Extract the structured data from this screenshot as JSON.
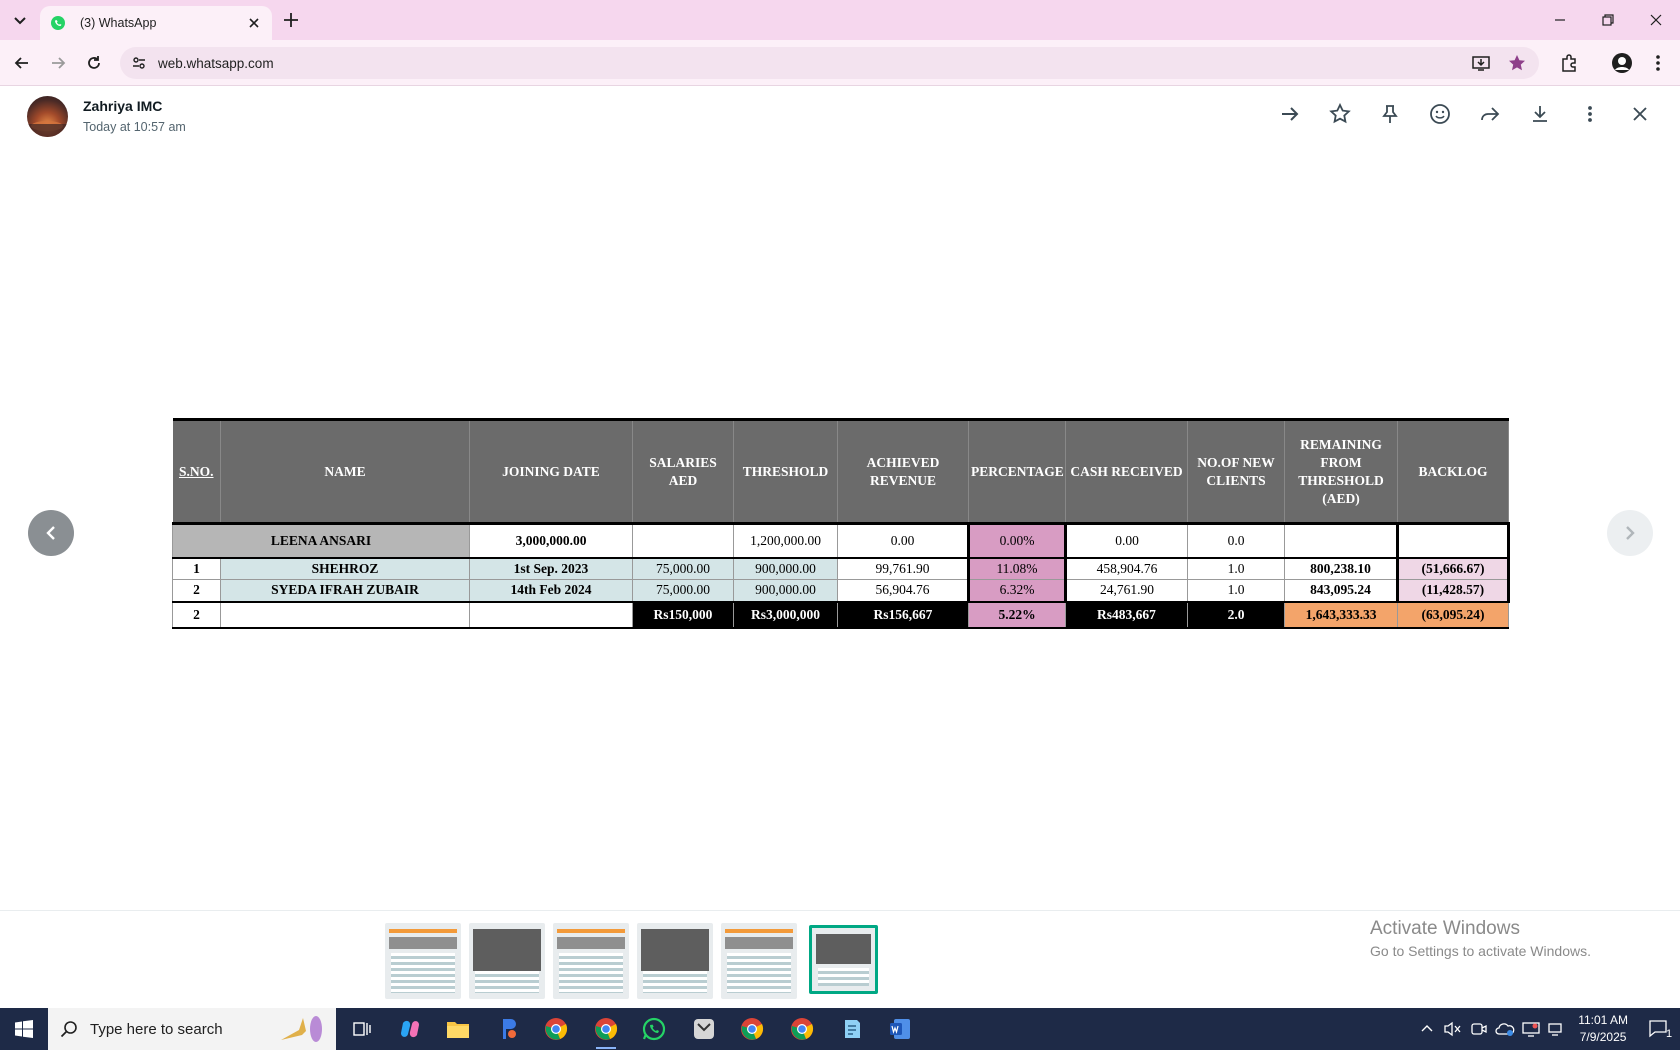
{
  "browser": {
    "tab_title": "(3) WhatsApp",
    "url": "web.whatsapp.com"
  },
  "viewer": {
    "sender_name": "Zahriya IMC",
    "timestamp": "Today at 10:57 am",
    "actions": [
      "arrow-right-icon",
      "star-icon",
      "pin-icon",
      "emoji-icon",
      "forward-icon",
      "download-icon",
      "more-icon",
      "close-icon"
    ]
  },
  "sheet": {
    "headers": [
      "S.NO.",
      "NAME",
      "JOINING DATE",
      "SALARIES AED",
      "THRESHOLD",
      "ACHIEVED REVENUE",
      "PERCENTAGE",
      "CASH RECEIVED",
      "NO.OF NEW CLIENTS",
      "REMAINING FROM THRESHOLD (AED)",
      "BACKLOG"
    ],
    "lead": {
      "name": "LEENA ANSARI",
      "joining": "3,000,000.00",
      "salaries": "",
      "threshold": "1,200,000.00",
      "revenue": "0.00",
      "percentage": "0.00%",
      "cash": "0.00",
      "clients": "0.0",
      "remaining": "",
      "backlog": ""
    },
    "rows": [
      {
        "sno": "1",
        "name": "SHEHROZ",
        "joining": "1st Sep. 2023",
        "salaries": "75,000.00",
        "threshold": "900,000.00",
        "revenue": "99,761.90",
        "percentage": "11.08%",
        "cash": "458,904.76",
        "clients": "1.0",
        "remaining": "800,238.10",
        "backlog": "(51,666.67)"
      },
      {
        "sno": "2",
        "name": "SYEDA IFRAH ZUBAIR",
        "joining": "14th Feb 2024",
        "salaries": "75,000.00",
        "threshold": "900,000.00",
        "revenue": "56,904.76",
        "percentage": "6.32%",
        "cash": "24,761.90",
        "clients": "1.0",
        "remaining": "843,095.24",
        "backlog": "(11,428.57)"
      }
    ],
    "total": {
      "sno": "2",
      "name": "",
      "joining": "",
      "salaries": "Rs150,000",
      "threshold": "Rs3,000,000",
      "revenue": "Rs156,667",
      "percentage": "5.22%",
      "cash": "Rs483,667",
      "clients": "2.0",
      "remaining": "1,643,333.33",
      "backlog": "(63,095.24)"
    }
  },
  "watermark": {
    "title": "Activate Windows",
    "subtitle": "Go to Settings to activate Windows."
  },
  "taskbar": {
    "search_placeholder": "Type here to search",
    "time": "11:01 AM",
    "date": "7/9/2025",
    "notification_count": "1"
  },
  "colors": {
    "tab_strip": "#f6d7ee",
    "toolbar": "#fcf0f8",
    "header_grey": "#6b6b6b",
    "pink": "#d89cc3",
    "orange": "#f3a46a",
    "teal": "#d4e5e7",
    "whatsapp_green": "#00a884"
  }
}
